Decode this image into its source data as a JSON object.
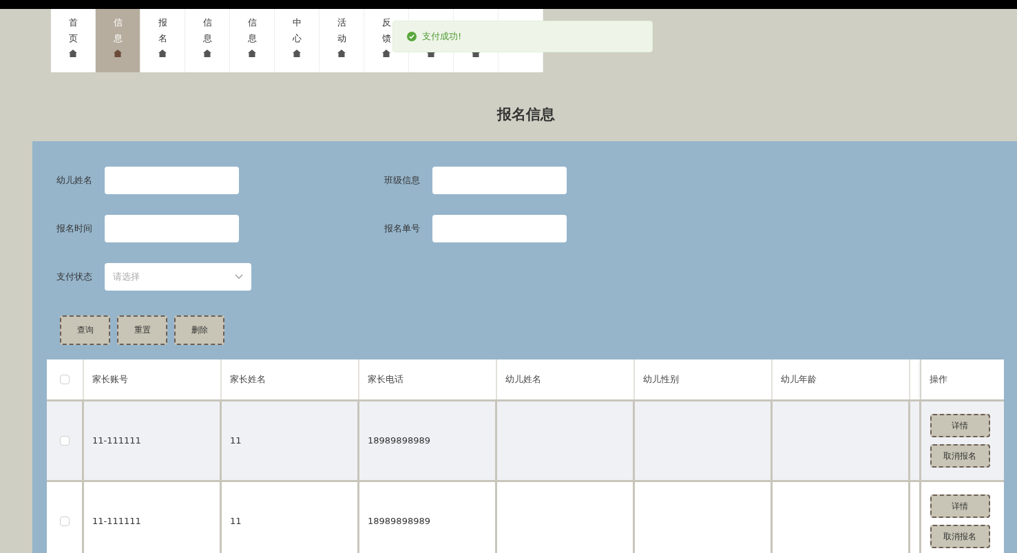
{
  "nav": [
    {
      "label": "首页",
      "selected": false,
      "icon": true
    },
    {
      "label": "信息",
      "selected": true,
      "icon": true
    },
    {
      "label": "报名",
      "selected": false,
      "icon": true
    },
    {
      "label": "信息",
      "selected": false,
      "icon": true
    },
    {
      "label": "信息",
      "selected": false,
      "icon": true
    },
    {
      "label": "中心",
      "selected": false,
      "icon": true
    },
    {
      "label": "活动",
      "selected": false,
      "icon": true
    },
    {
      "label": "反馈",
      "selected": false,
      "icon": true
    },
    {
      "selected": false,
      "icon": true
    },
    {
      "selected": false,
      "icon": true
    },
    {
      "selected": false,
      "icon": false
    }
  ],
  "toast": {
    "message": "支付成功!"
  },
  "title": "报名信息",
  "filters": [
    {
      "kind": "text",
      "label": "幼儿姓名"
    },
    {
      "kind": "text",
      "label": "班级信息"
    },
    {
      "kind": "text",
      "label": "报名时间"
    },
    {
      "kind": "text",
      "label": "报名单号"
    },
    {
      "kind": "select",
      "label": "支付状态",
      "placeholder": "请选择"
    }
  ],
  "actions": [
    "查询",
    "重置",
    "删除"
  ],
  "table": {
    "all_checked": false,
    "columns": [
      "家长账号",
      "家长姓名",
      "家长电话",
      "幼儿姓名",
      "幼儿性别",
      "幼儿年龄"
    ],
    "action_column": "操作",
    "rows": [
      {
        "checked": false,
        "highlighted": true,
        "cells": [
          "11-111111",
          "11",
          "18989898989",
          "",
          "",
          ""
        ],
        "buttons": [
          "详情",
          "取消报名"
        ]
      },
      {
        "checked": false,
        "highlighted": false,
        "cells": [
          "11-111111",
          "11",
          "18989898989",
          "",
          "",
          ""
        ],
        "buttons": [
          "详情",
          "取消报名"
        ]
      }
    ]
  }
}
